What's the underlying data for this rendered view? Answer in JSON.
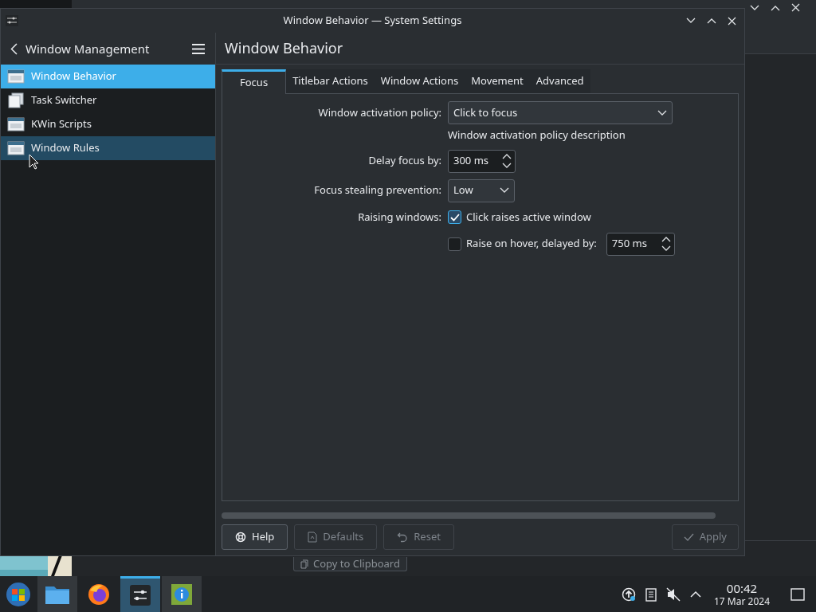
{
  "background_window": {
    "button": "Copy to Clipboard"
  },
  "window": {
    "title": "Window Behavior — System Settings"
  },
  "sidebar": {
    "title": "Window Management",
    "items": [
      {
        "label": "Window Behavior",
        "selected": true,
        "hovered": false
      },
      {
        "label": "Task Switcher",
        "selected": false,
        "hovered": false
      },
      {
        "label": "KWin Scripts",
        "selected": false,
        "hovered": false
      },
      {
        "label": "Window Rules",
        "selected": false,
        "hovered": true
      }
    ]
  },
  "page": {
    "title": "Window Behavior",
    "tabs": [
      {
        "label": "Focus",
        "selected": true
      },
      {
        "label": "Titlebar Actions",
        "selected": false
      },
      {
        "label": "Window Actions",
        "selected": false
      },
      {
        "label": "Movement",
        "selected": false
      },
      {
        "label": "Advanced",
        "selected": false
      }
    ],
    "rows": [
      {
        "kind": "wide_combo",
        "label": "Window activation policy:",
        "value": "Click to focus"
      },
      {
        "kind": "note",
        "text": "Window activation policy description"
      },
      {
        "kind": "spin",
        "label": "Delay focus by:",
        "value": "300 ms"
      },
      {
        "kind": "combo",
        "label": "Focus stealing prevention:",
        "value": "Low"
      },
      {
        "kind": "check",
        "label": "Raising windows:",
        "text": "Click raises active window",
        "checked": true
      },
      {
        "kind": "check_spin",
        "text": "Raise on hover, delayed by:",
        "checked": false,
        "value": "750 ms"
      }
    ]
  },
  "footer": {
    "buttons": [
      {
        "label": "Help",
        "kind": "help",
        "disabled": false
      },
      {
        "label": "Defaults",
        "kind": "defaults",
        "disabled": true
      },
      {
        "label": "Reset",
        "kind": "reset",
        "disabled": true
      }
    ],
    "apply": {
      "label": "Apply",
      "disabled": true
    }
  },
  "taskbar": {
    "tasks": [
      {
        "kind": "files",
        "active": false
      },
      {
        "kind": "browser",
        "active": false
      },
      {
        "kind": "settings",
        "active": true
      },
      {
        "kind": "info",
        "active": false
      }
    ],
    "time": "00:42",
    "date": "17 Mar 2024"
  }
}
